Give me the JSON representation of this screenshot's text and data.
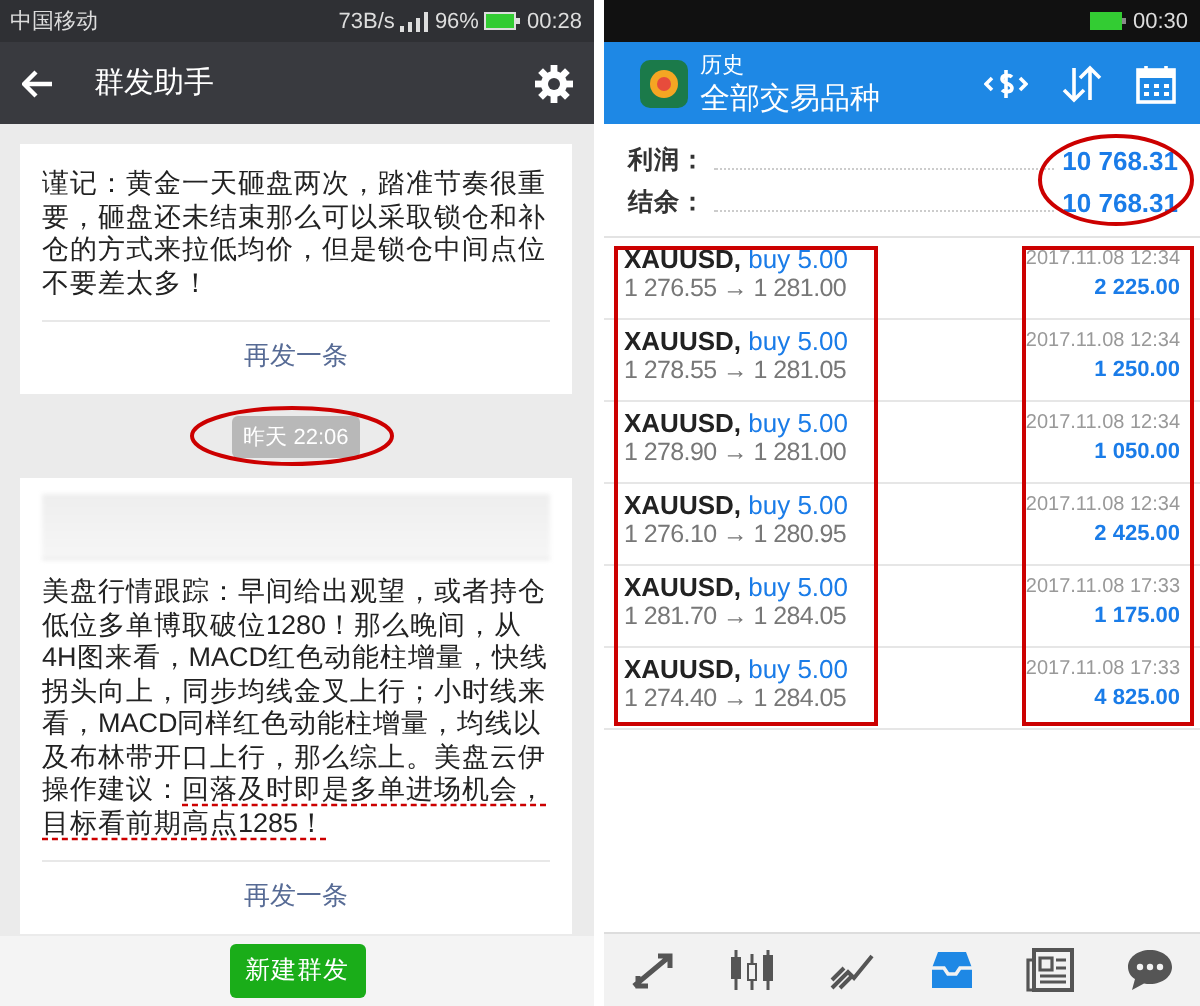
{
  "left_screen": {
    "status_bar": {
      "carrier": "中国移动",
      "speed": "73B/s",
      "battery": "96%",
      "time": "00:28"
    },
    "header": {
      "title": "群发助手"
    },
    "feed": [
      {
        "kind": "card",
        "blurred": false,
        "text": "谨记：黄金一天砸盘两次，踏准节奏很重要，砸盘还未结束那么可以采取锁仓和补仓的方式来拉低均价，但是锁仓中间点位不要差太多！",
        "resend": "再发一条"
      },
      {
        "kind": "time",
        "text": "昨天 22:06",
        "circled": true
      },
      {
        "kind": "card",
        "blurred": true,
        "text": "美盘行情跟踪：早间给出观望，或者持仓低位多单博取破位1280！那么晚间，从4H图来看，MACD红色动能柱增量，快线拐头向上，同步均线金叉上行；小时线来看，MACD同样红色动能柱增量，均线以及布林带开口上行，那么综上。美盘云伊操作建议：",
        "underlined": "回落及时即是多单进场机会，目标看前期高点1285！",
        "resend": "再发一条"
      }
    ],
    "button": "新建群发"
  },
  "right_screen": {
    "status_bar": {
      "time": "00:30"
    },
    "header": {
      "subtitle": "历史",
      "title": "全部交易品种"
    },
    "summary_circled": true,
    "summary": [
      {
        "label": "利润：",
        "value": "10 768.31"
      },
      {
        "label": "结余：",
        "value": "10 768.31"
      }
    ],
    "trades_boxed": true,
    "trades": [
      {
        "symbol": "XAUUSD,",
        "side": "buy 5.00",
        "prices": "1 276.55 → 1 281.00",
        "time": "2017.11.08 12:34",
        "profit": "2 225.00"
      },
      {
        "symbol": "XAUUSD,",
        "side": "buy 5.00",
        "prices": "1 278.55 → 1 281.05",
        "time": "2017.11.08 12:34",
        "profit": "1 250.00"
      },
      {
        "symbol": "XAUUSD,",
        "side": "buy 5.00",
        "prices": "1 278.90 → 1 281.00",
        "time": "2017.11.08 12:34",
        "profit": "1 050.00"
      },
      {
        "symbol": "XAUUSD,",
        "side": "buy 5.00",
        "prices": "1 276.10 → 1 280.95",
        "time": "2017.11.08 12:34",
        "profit": "2 425.00"
      },
      {
        "symbol": "XAUUSD,",
        "side": "buy 5.00",
        "prices": "1 281.70 → 1 284.05",
        "time": "2017.11.08 17:33",
        "profit": "1 175.00"
      },
      {
        "symbol": "XAUUSD,",
        "side": "buy 5.00",
        "prices": "1 274.40 → 1 284.05",
        "time": "2017.11.08 17:33",
        "profit": "4 825.00"
      }
    ],
    "nav": [
      {
        "kind": "trade",
        "selected": false
      },
      {
        "kind": "quotes",
        "selected": false
      },
      {
        "kind": "chart",
        "selected": false
      },
      {
        "kind": "history",
        "selected": true
      },
      {
        "kind": "news",
        "selected": false
      },
      {
        "kind": "chat",
        "selected": false
      }
    ]
  }
}
